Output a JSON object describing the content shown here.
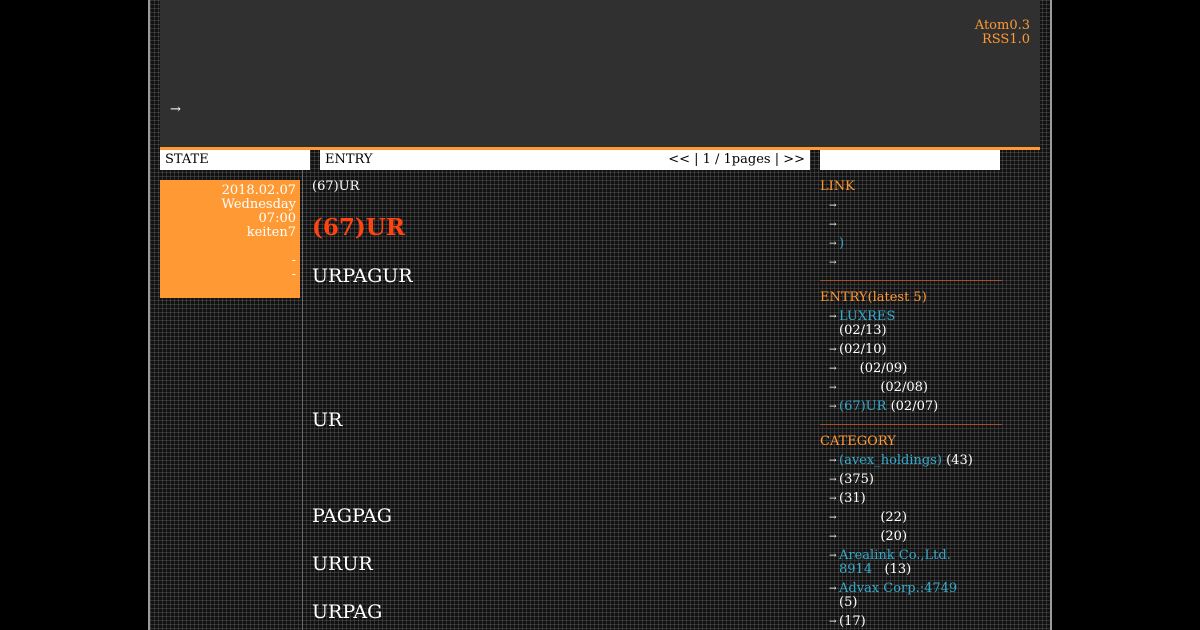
{
  "header": {
    "feeds": [
      "Atom0.3",
      "RSS1.0"
    ],
    "arrow": "→"
  },
  "bars": {
    "state": "STATE",
    "entry": "ENTRY",
    "pager": "<< | 1 / 1pages | >>",
    "right": ""
  },
  "state_box": {
    "date": "2018.02.07",
    "weekday": "Wednesday",
    "time": "07:00",
    "author": "keiten7",
    "dot1": "-",
    "dot2": "-"
  },
  "entry": {
    "small_title": "(67)UR",
    "title": "(67)UR",
    "lines": [
      "URPAGUR",
      "UR",
      "PAGPAG",
      "URUR",
      "URPAG"
    ]
  },
  "sidebar": {
    "link_heading": "LINK",
    "links": [
      "",
      "",
      ")",
      ""
    ],
    "entry_heading": "ENTRY(latest 5)",
    "entries": [
      {
        "title": "LUXRES",
        "date": "(02/13)"
      },
      {
        "title": "",
        "date": "(02/10)"
      },
      {
        "title": "",
        "date": "(02/09)"
      },
      {
        "title": "",
        "date": "(02/08)"
      },
      {
        "title": "(67)UR",
        "date": "(02/07)"
      }
    ],
    "category_heading": "CATEGORY",
    "categories": [
      {
        "name": "(avex_holdings)",
        "count": "(43)"
      },
      {
        "name": "",
        "count": "(375)"
      },
      {
        "name": "",
        "count": "(31)"
      },
      {
        "name": "",
        "count": "(22)"
      },
      {
        "name": "",
        "count": "(20)"
      },
      {
        "name": "Arealink Co.,Ltd. 8914",
        "count": "(13)"
      },
      {
        "name": "Advax Corp.:4749",
        "count": "(5)"
      },
      {
        "name": "",
        "count": "(17)"
      }
    ],
    "bullet": "→"
  },
  "colors": {
    "accent": "#ff9933",
    "title_red": "#ff4411",
    "link": "#33aacc",
    "header_bg": "#303030"
  }
}
